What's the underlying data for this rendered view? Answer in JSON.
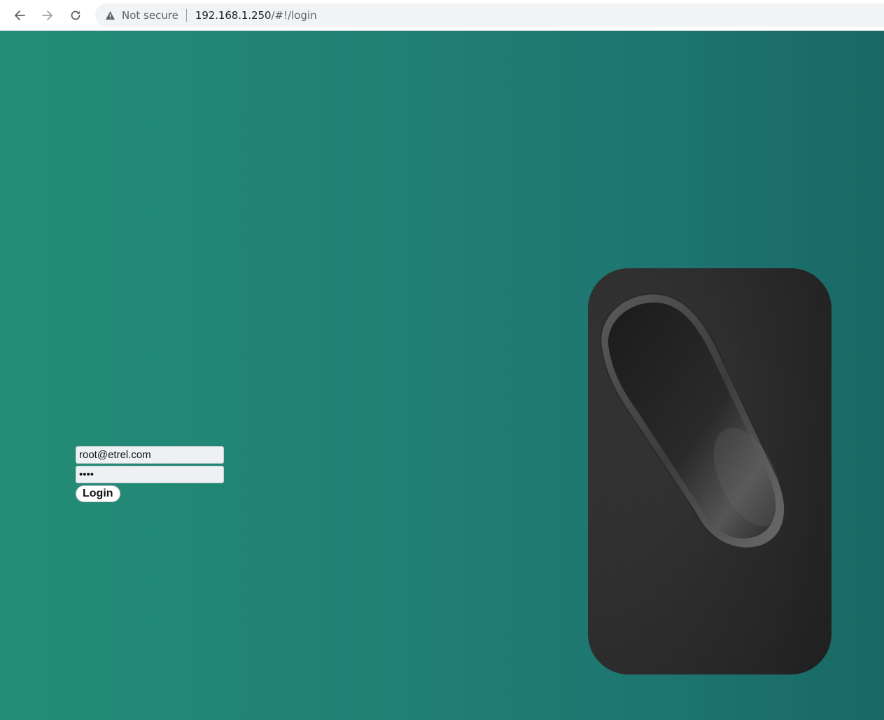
{
  "browser": {
    "back_icon": "arrow-left-icon",
    "forward_icon": "arrow-right-icon",
    "reload_icon": "reload-icon",
    "security_icon": "warning-triangle-icon",
    "security_label": "Not secure",
    "url_host": "192.168.1.250",
    "url_path": "/#!/login"
  },
  "page": {
    "background_colors": [
      "#248d77",
      "#196865"
    ]
  },
  "login": {
    "email_value": "root@etrel.com",
    "password_value": "1234",
    "submit_label": "Login"
  },
  "device": {
    "icon": "ev-charger-device-image",
    "body_color": "#333333"
  }
}
